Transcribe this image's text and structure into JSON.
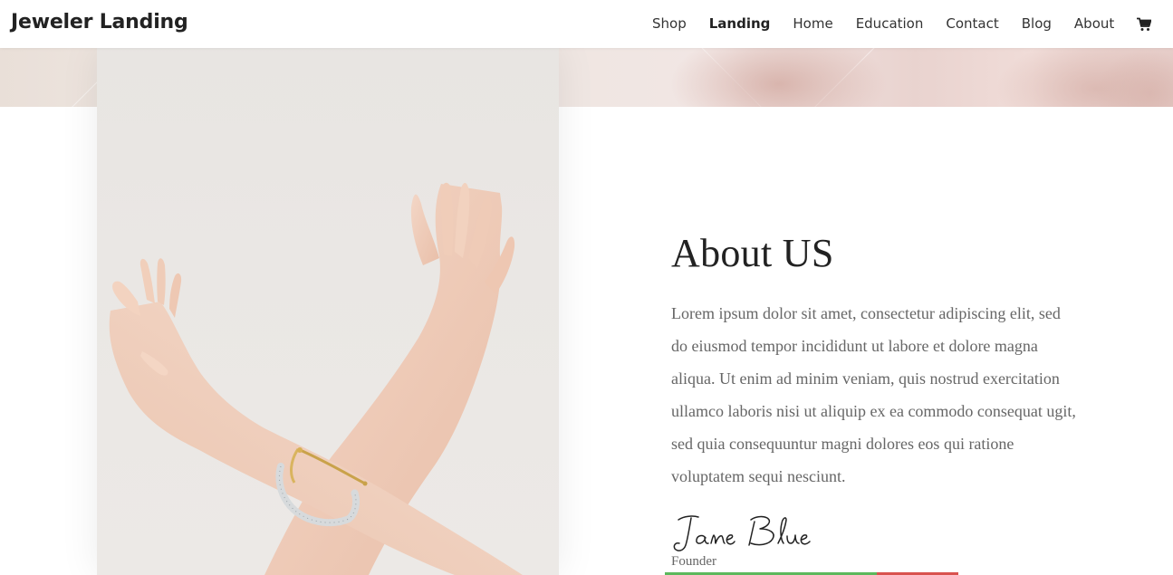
{
  "header": {
    "site_title": "Jeweler Landing",
    "nav": [
      {
        "label": "Shop",
        "active": false
      },
      {
        "label": "Landing",
        "active": true
      },
      {
        "label": "Home",
        "active": false
      },
      {
        "label": "Education",
        "active": false
      },
      {
        "label": "Contact",
        "active": false
      },
      {
        "label": "Blog",
        "active": false
      },
      {
        "label": "About",
        "active": false
      }
    ],
    "cart_icon": "cart-icon"
  },
  "about": {
    "title": "About US",
    "body": "Lorem ipsum dolor sit amet, consectetur adipiscing elit, sed do eiusmod tempor incididunt ut labore et dolore magna aliqua. Ut enim ad minim veniam, quis nostrud exercitation ullamco laboris nisi ut aliquip ex ea commodo consequat ugit, sed quia consequuntur magni dolores eos qui ratione voluptatem sequi nesciunt.",
    "signature": "Jane Blue",
    "role": "Founder"
  },
  "colors": {
    "text_dark": "#222222",
    "text_muted": "#666666",
    "photo_bg": "#e9e6e3",
    "bar_green": "#5cb85c",
    "bar_red": "#d9534f"
  }
}
